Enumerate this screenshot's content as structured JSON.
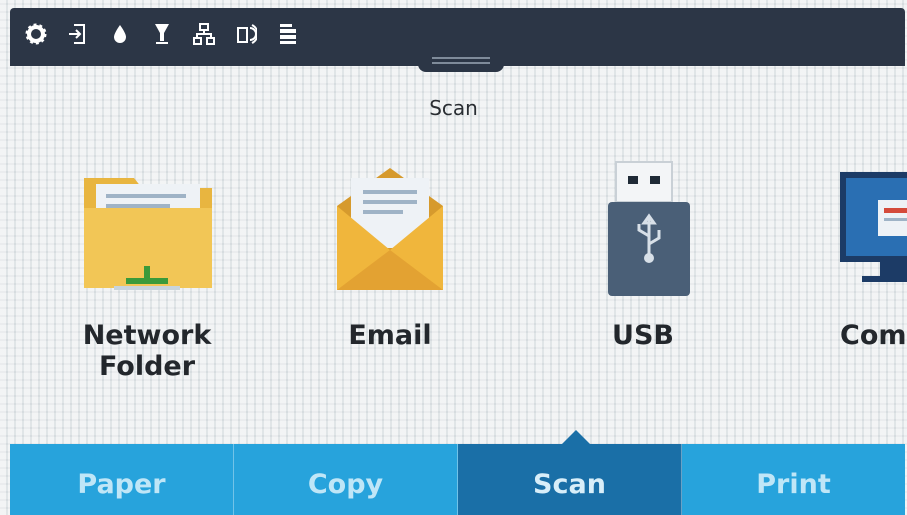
{
  "status_bar": {
    "icons": [
      "gear-icon",
      "sign-in-icon",
      "ink-drop-icon",
      "toner-icon",
      "network-icon",
      "wifi-direct-icon",
      "job-queue-icon"
    ]
  },
  "screen": {
    "title": "Scan"
  },
  "options": [
    {
      "label": "Network Folder",
      "icon": "network-folder-icon"
    },
    {
      "label": "Email",
      "icon": "email-icon"
    },
    {
      "label": "USB",
      "icon": "usb-icon"
    },
    {
      "label": "Comp",
      "icon": "computer-icon"
    }
  ],
  "tabs": [
    {
      "label": "Paper"
    },
    {
      "label": "Copy"
    },
    {
      "label": "Scan"
    },
    {
      "label": "Print"
    }
  ],
  "colors": {
    "status_bar": "#2c3646",
    "tab": "#27a3dc",
    "tab_active": "#1a6fa7"
  }
}
